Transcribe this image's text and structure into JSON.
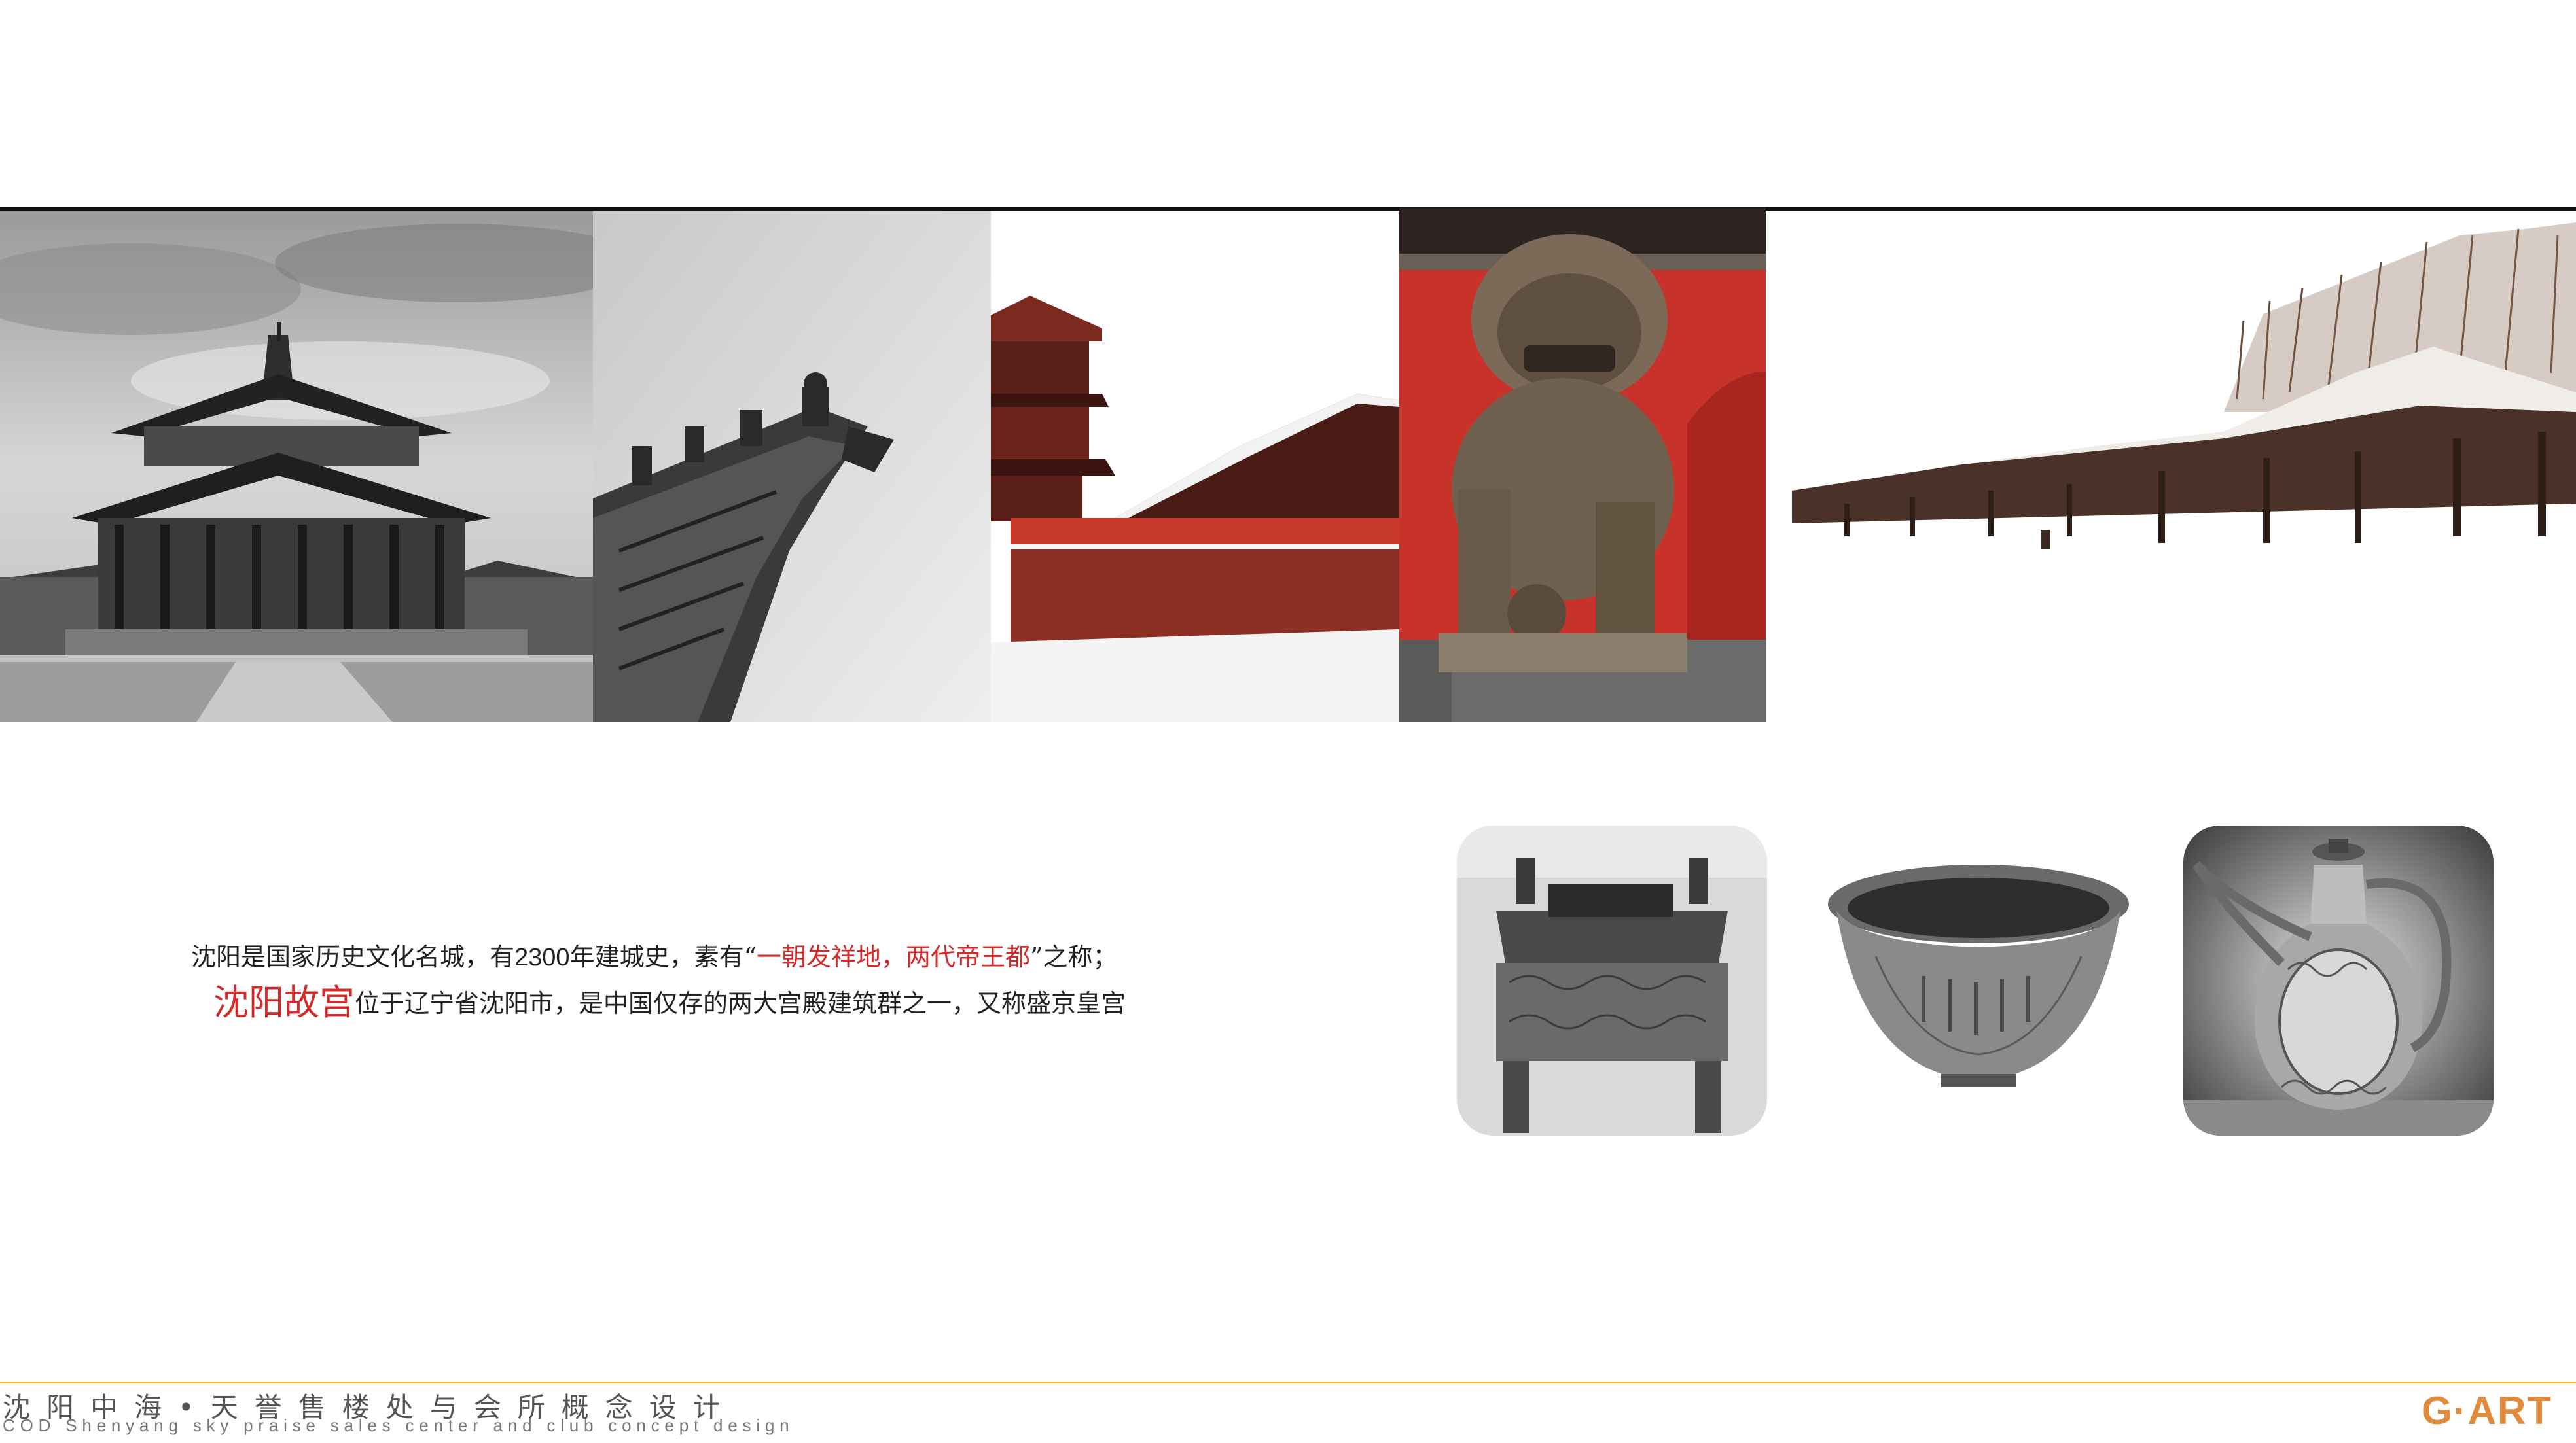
{
  "photos": [
    {
      "name": "palace-pavilion-photo",
      "tone": "grayscale"
    },
    {
      "name": "roof-ridge-beasts-photo",
      "tone": "grayscale"
    },
    {
      "name": "snowy-tower-red-wall-photo",
      "tone": "color"
    },
    {
      "name": "stone-lion-red-wall-photo",
      "tone": "color"
    },
    {
      "name": "snowy-courtyard-halls-photo",
      "tone": "sepia"
    }
  ],
  "caption": {
    "line1_pre": "沈阳是国家历史文化名城，有",
    "line1_num": "2300",
    "line1_mid": "年建城史，素有“",
    "line1_highlight": "一朝发祥地，两代帝王都",
    "line1_post": "”之称；",
    "line2_highlight": "沈阳故宫",
    "line2_rest": "位于辽宁省沈阳市，是中国仅存的两大宫殿建筑群之一，又称盛京皇宫"
  },
  "artifacts": [
    {
      "name": "bronze-ding-vessel-photo"
    },
    {
      "name": "inscribed-bowl-photo"
    },
    {
      "name": "porcelain-ewer-photo"
    }
  ],
  "footer": {
    "title": "沈阳中海•天誉售楼处与会所概念设计",
    "subtitle": "COD Shenyang sky praise sales center and club concept design",
    "logo": "G·ART"
  },
  "colors": {
    "accent_red": "#d42a2a",
    "footer_rule": "#e7b43c",
    "logo_orange": "#e08a3c"
  }
}
